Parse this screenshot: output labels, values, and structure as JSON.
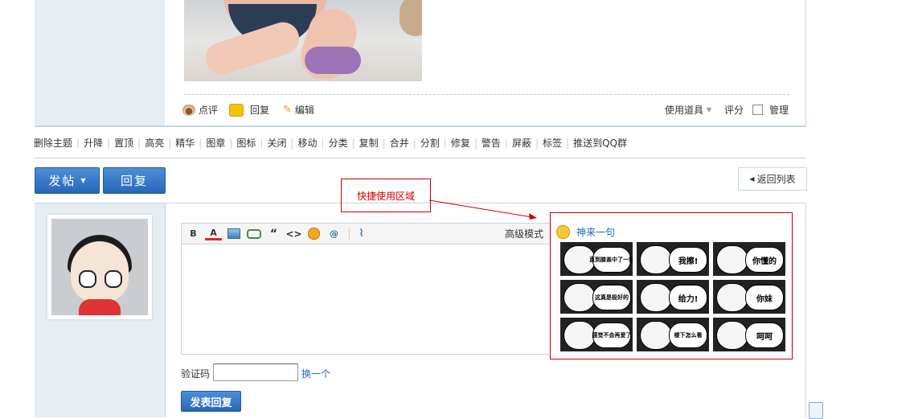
{
  "post": {
    "actions": {
      "rate": "点评",
      "reply": "回复",
      "edit": "编辑"
    },
    "tools": {
      "use_tools": "使用道具",
      "score": "评分",
      "manage": "管理"
    }
  },
  "moderation": [
    "删除主题",
    "升降",
    "置顶",
    "高亮",
    "精华",
    "图章",
    "图标",
    "关闭",
    "移动",
    "分类",
    "复制",
    "合并",
    "分割",
    "修复",
    "警告",
    "屏蔽",
    "标签",
    "推送到QQ群"
  ],
  "buttons": {
    "new_post": "发帖",
    "reply": "回复",
    "back_to_list": "返回列表",
    "submit_reply": "发表回复"
  },
  "annotation": {
    "label": "快捷使用区域"
  },
  "editor": {
    "toolbar": [
      "B",
      "A",
      "img",
      "link",
      "quote",
      "code",
      "smiley",
      "@",
      "attach"
    ],
    "advanced_mode": "高级模式"
  },
  "quick_panel": {
    "title": "神来一句",
    "emoticons": [
      "直到膝盖中了一箭",
      "我擦!",
      "你懂的",
      "这真是极好的",
      "给力!",
      "你妹",
      "感觉不会再爱了",
      "楼下怎么看",
      "呵呵"
    ]
  },
  "captcha": {
    "label": "验证码",
    "refresh": "换一个",
    "value": ""
  },
  "colors": {
    "accent_blue": "#2566B8",
    "annotation_red": "#CC0000",
    "sidebar_bg": "#E5EDF2",
    "border": "#C2D5E3"
  }
}
